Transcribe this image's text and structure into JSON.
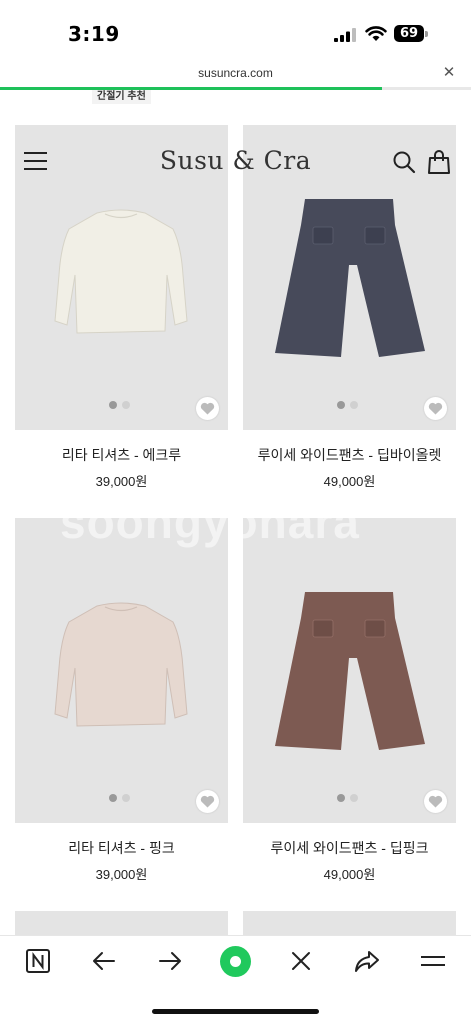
{
  "status_bar": {
    "time": "3:19",
    "battery": "69",
    "icons": [
      "signal-icon",
      "wifi-icon",
      "battery-icon"
    ]
  },
  "browser": {
    "url": "susuncra.com",
    "close_icon": "close-icon",
    "load_progress": 0.81,
    "progress_color": "#1ec15a"
  },
  "partial_banner": "간절기 추천",
  "site_header": {
    "logo": "Susu & Cra",
    "icons": [
      "menu-icon",
      "search-icon",
      "shopping-bag-icon"
    ]
  },
  "watermark": "soongyonara",
  "products": [
    {
      "name": "리타 티셔츠 - 에크루",
      "price": "39,000원",
      "garment": "long-sleeve-tee",
      "color": "#f1efe6",
      "active_dot": 1,
      "dots": 2
    },
    {
      "name": "루이세 와이드팬츠 - 딥바이올렛",
      "price": "49,000원",
      "garment": "wide-pants",
      "color": "#474a5a",
      "active_dot": 1,
      "dots": 2
    },
    {
      "name": "리타 티셔츠 - 핑크",
      "price": "39,000원",
      "garment": "long-sleeve-tee",
      "color": "#e6d8d0",
      "active_dot": 1,
      "dots": 2
    },
    {
      "name": "루이세 와이드팬츠 - 딥핑크",
      "price": "49,000원",
      "garment": "wide-pants",
      "color": "#7d5a52",
      "active_dot": 1,
      "dots": 2
    }
  ],
  "toolbar": {
    "buttons": [
      "naver-icon",
      "back-arrow-icon",
      "forward-arrow-icon",
      "home-circle-icon",
      "close-icon",
      "share-icon",
      "menu-icon"
    ],
    "accent": "#20c95d"
  }
}
